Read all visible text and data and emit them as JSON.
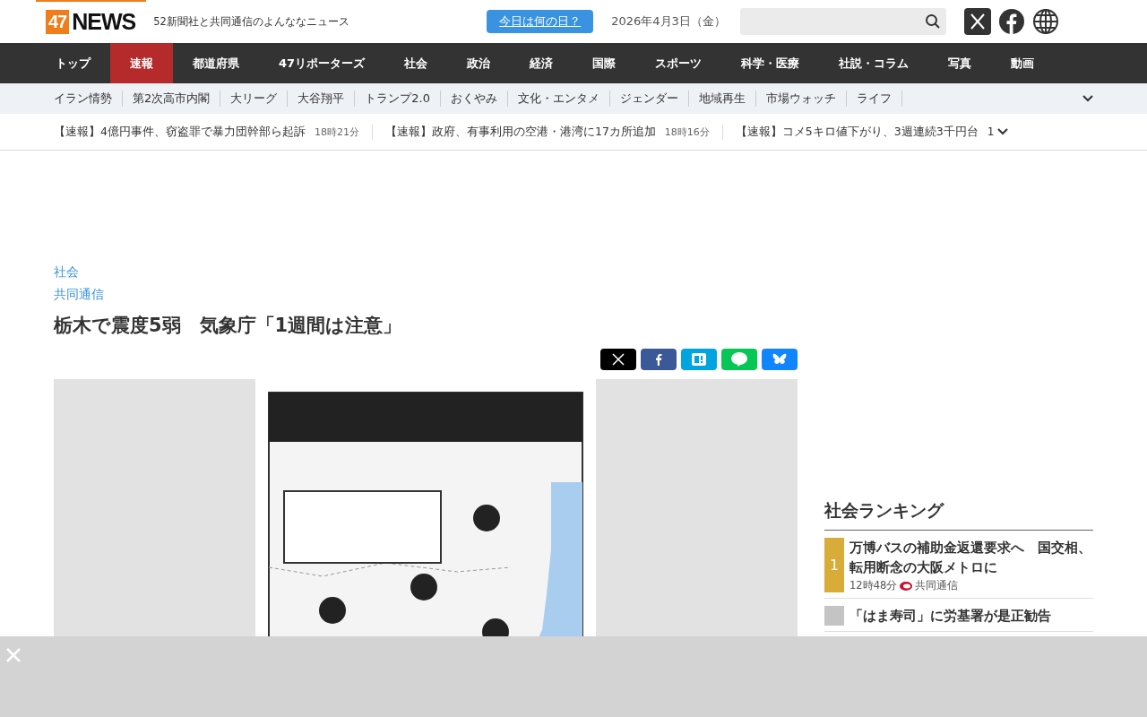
{
  "header": {
    "logo": {
      "number": "47",
      "word": "NEWS"
    },
    "tagline": "52新聞社と共同通信のよんななニュース",
    "today_button": "今日は何の日？",
    "date": "2026年4月3日（金）"
  },
  "nav": [
    {
      "label": "トップ",
      "selected": false
    },
    {
      "label": "速報",
      "selected": true
    },
    {
      "label": "都道府県",
      "selected": false
    },
    {
      "label": "47リポーターズ",
      "selected": false
    },
    {
      "label": "社会",
      "selected": false
    },
    {
      "label": "政治",
      "selected": false
    },
    {
      "label": "経済",
      "selected": false
    },
    {
      "label": "国際",
      "selected": false
    },
    {
      "label": "スポーツ",
      "selected": false
    },
    {
      "label": "科学・医療",
      "selected": false
    },
    {
      "label": "社説・コラム",
      "selected": false
    },
    {
      "label": "写真",
      "selected": false
    },
    {
      "label": "動画",
      "selected": false
    }
  ],
  "topics": [
    "イラン情勢",
    "第2次高市内閣",
    "大リーグ",
    "大谷翔平",
    "トランプ2.0",
    "おくやみ",
    "文化・エンタメ",
    "ジェンダー",
    "地域再生",
    "市場ウォッチ",
    "ライフ"
  ],
  "ticker": {
    "items": [
      {
        "headline": "【速報】4億円事件、窃盗罪で暴力団幹部ら起訴",
        "time": "18時21分"
      },
      {
        "headline": "【速報】政府、有事利用の空港・港湾に17カ所追加",
        "time": "18時16分"
      },
      {
        "headline": "【速報】コメ5キロ値下がり、3週連続3千円台"
      }
    ],
    "page": "1"
  },
  "article": {
    "category": "社会",
    "source": "共同通信",
    "title": "栃木で震度5弱　気象庁「1週間は注意」",
    "share": [
      {
        "kind": "x"
      },
      {
        "kind": "facebook"
      },
      {
        "kind": "hatena"
      },
      {
        "kind": "line"
      },
      {
        "kind": "bluesky"
      }
    ]
  },
  "ranking": {
    "title": "社会ランキング",
    "items": [
      {
        "rank": "1",
        "color": "#d9ac3a",
        "title": "万博バスの補助金返還要求へ　国交相、転用断念の大阪メトロに",
        "time": "12時48分",
        "source": "共同通信"
      },
      {
        "color": "#c4c4c4",
        "title": "「はま寿司」に労基署が是正勧告"
      }
    ]
  }
}
